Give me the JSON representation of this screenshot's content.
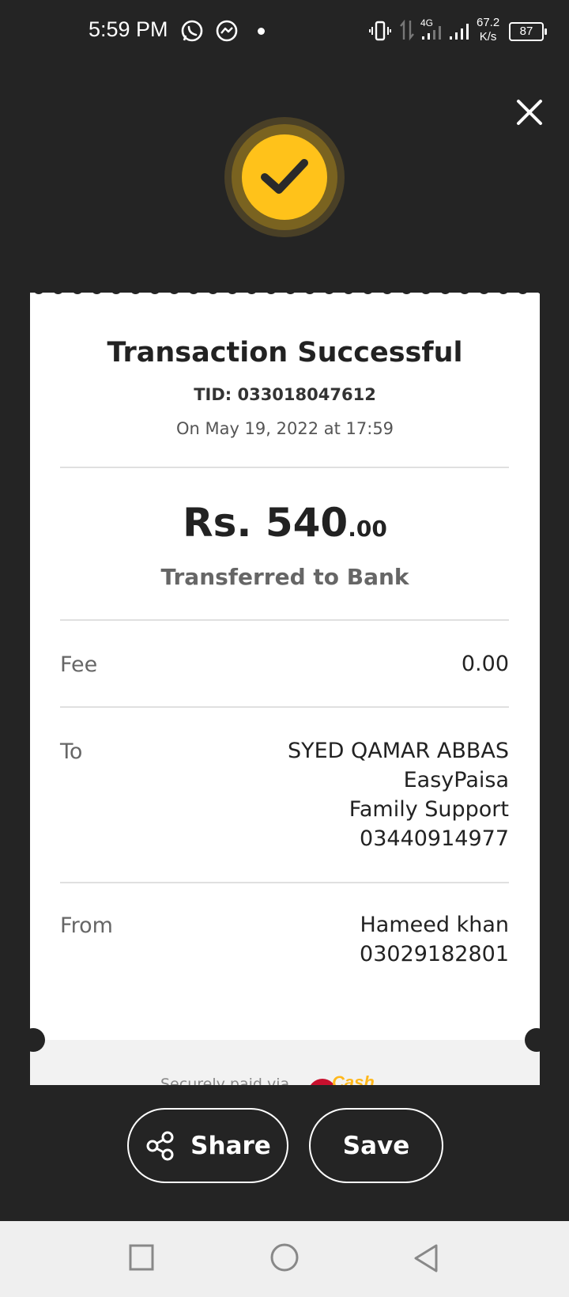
{
  "status_bar": {
    "time": "5:59 PM",
    "network": "4G",
    "speed_value": "67.2",
    "speed_unit": "K/s",
    "battery": "87"
  },
  "receipt": {
    "title": "Transaction Successful",
    "tid": "TID: 033018047612",
    "date": "On May 19, 2022 at 17:59",
    "amount_main": "Rs. 540",
    "amount_decimal": ".00",
    "amount_subtitle": "Transferred to Bank",
    "fee_label": "Fee",
    "fee_value": "0.00",
    "to_label": "To",
    "to_lines": [
      "SYED QAMAR ABBAS",
      "EasyPaisa",
      "Family Support",
      "03440914977"
    ],
    "from_label": "From",
    "from_lines": [
      "Hameed khan",
      "03029182801"
    ],
    "footer_text": "Securely paid via",
    "footer_logo_text": "Cash"
  },
  "actions": {
    "share_label": "Share",
    "save_label": "Save"
  },
  "colors": {
    "background": "#242424",
    "accent": "#ffc21a",
    "card": "#ffffff"
  }
}
